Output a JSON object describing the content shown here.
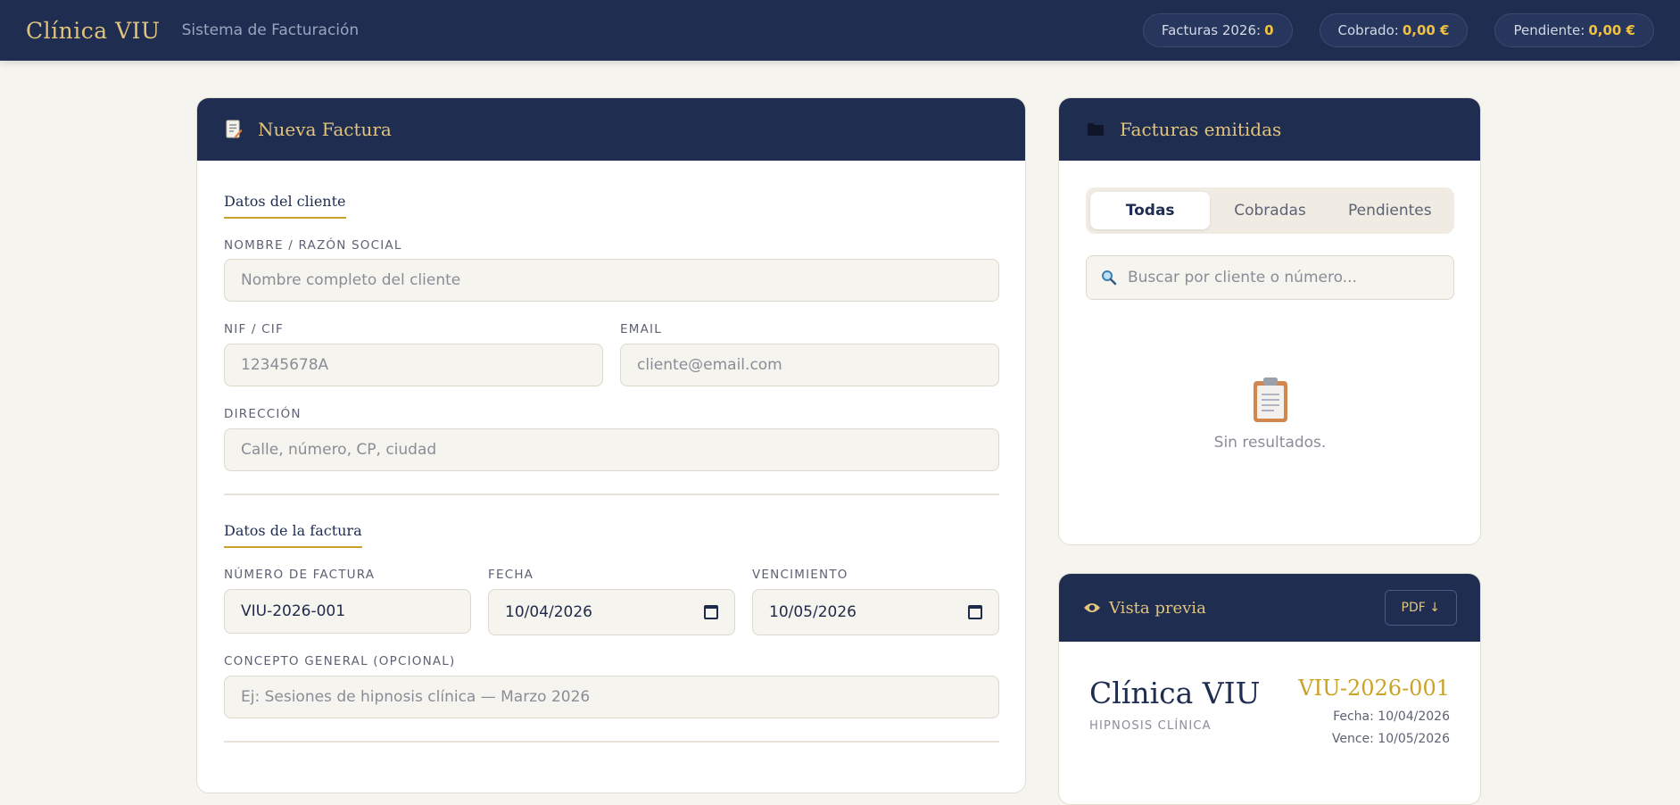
{
  "header": {
    "brand": "Clínica VIU",
    "subtitle": "Sistema de Facturación",
    "stats": [
      {
        "label": "Facturas 2026:",
        "value": "0"
      },
      {
        "label": "Cobrado:",
        "value": "0,00 €"
      },
      {
        "label": "Pendiente:",
        "value": "0,00 €"
      }
    ]
  },
  "new_invoice": {
    "title": "Nueva Factura",
    "icon": "memo-icon",
    "client_section": "Datos del cliente",
    "name_label": "NOMBRE / RAZÓN SOCIAL",
    "name_placeholder": "Nombre completo del cliente",
    "nif_label": "NIF / CIF",
    "nif_placeholder": "12345678A",
    "email_label": "EMAIL",
    "email_placeholder": "cliente@email.com",
    "address_label": "DIRECCIÓN",
    "address_placeholder": "Calle, número, CP, ciudad",
    "invoice_section": "Datos de la factura",
    "number_label": "NÚMERO DE FACTURA",
    "number_value": "VIU-2026-001",
    "date_label": "FECHA",
    "date_value": "10/04/2026",
    "due_label": "VENCIMIENTO",
    "due_value": "10/05/2026",
    "concept_label": "CONCEPTO GENERAL (OPCIONAL)",
    "concept_placeholder": "Ej: Sesiones de hipnosis clínica — Marzo 2026"
  },
  "issued": {
    "title": "Facturas emitidas",
    "icon": "folder-icon",
    "tabs": [
      "Todas",
      "Cobradas",
      "Pendientes"
    ],
    "active_tab": "Todas",
    "search_placeholder": "Buscar por cliente o número...",
    "empty_text": "Sin resultados."
  },
  "preview": {
    "title": "Vista previa",
    "icon": "eye-icon",
    "pdf_label": "PDF ↓",
    "clinic_name": "Clínica VIU",
    "clinic_tagline": "HIPNOSIS CLÍNICA",
    "invoice_number": "VIU-2026-001",
    "date_line": "Fecha: 10/04/2026",
    "due_line": "Vence: 10/05/2026"
  },
  "colors": {
    "navy": "#1e2d50",
    "gold": "#e2c47c",
    "accent_gold": "#c9a227",
    "background": "#f6f4ef"
  }
}
